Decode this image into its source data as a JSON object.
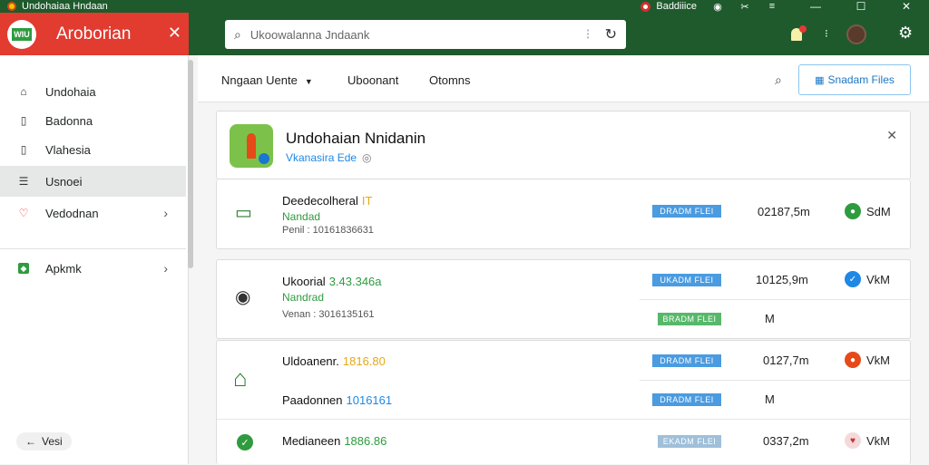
{
  "window": {
    "title": "Undohaiaa Hndaan",
    "status_text": "Baddiiice",
    "controls": [
      "—",
      "☐",
      "✕"
    ]
  },
  "brand": {
    "name": "Aroborian",
    "logo_text": "WIU"
  },
  "search": {
    "placeholder": "Ukoowalanna Jndaank"
  },
  "sidebar": {
    "items": [
      {
        "label": "Undohaia",
        "icon": "home-icon"
      },
      {
        "label": "Badonna",
        "icon": "doc-icon"
      },
      {
        "label": "Vlahesia",
        "icon": "doc-icon"
      },
      {
        "label": "Usnoei",
        "icon": "list-icon"
      },
      {
        "label": "Vedodnan",
        "icon": "shield-icon"
      },
      {
        "label": "Apkmk",
        "icon": "android-icon"
      }
    ],
    "footer": "Vesi"
  },
  "toolbar": {
    "tabs": [
      "Nngaan Uente",
      "Uboonant",
      "Otomns"
    ],
    "button": "Snadam Files"
  },
  "card": {
    "title": "Undohaian Nnidanin",
    "subtitle": "Vkanasira Ede",
    "rows": [
      {
        "name": "Deedecolheral",
        "accent": "IT",
        "status": "Nandad",
        "meta": "Penil : 10161836631",
        "pills": [
          "DRADM FLEI"
        ],
        "size": "02187,5m",
        "result": "SdM"
      },
      {
        "name": "Ukoorial",
        "accent": "3.43.346a",
        "status": "Nandrad",
        "meta": "Venan : 3016135161",
        "pills": [
          "UKADM FLEI",
          "BRADM FLEI"
        ],
        "size": "10125,9m",
        "result": "VkM",
        "result2": "M"
      },
      {
        "name": "Uldoanenr.",
        "accent": "1816.80",
        "status": "",
        "meta": "",
        "pills": [
          "DRADM FLEI",
          "DRADM FLEI"
        ],
        "size": "0127,7m",
        "result": "VkM",
        "sub_name": "Paadonnen",
        "sub_accent": "1016161",
        "result2": "M"
      },
      {
        "name": "Medianeen",
        "accent": "1886.86",
        "pills": [
          "EKADM FLEI"
        ],
        "size": "0337,2m",
        "result": "VkM"
      }
    ]
  }
}
